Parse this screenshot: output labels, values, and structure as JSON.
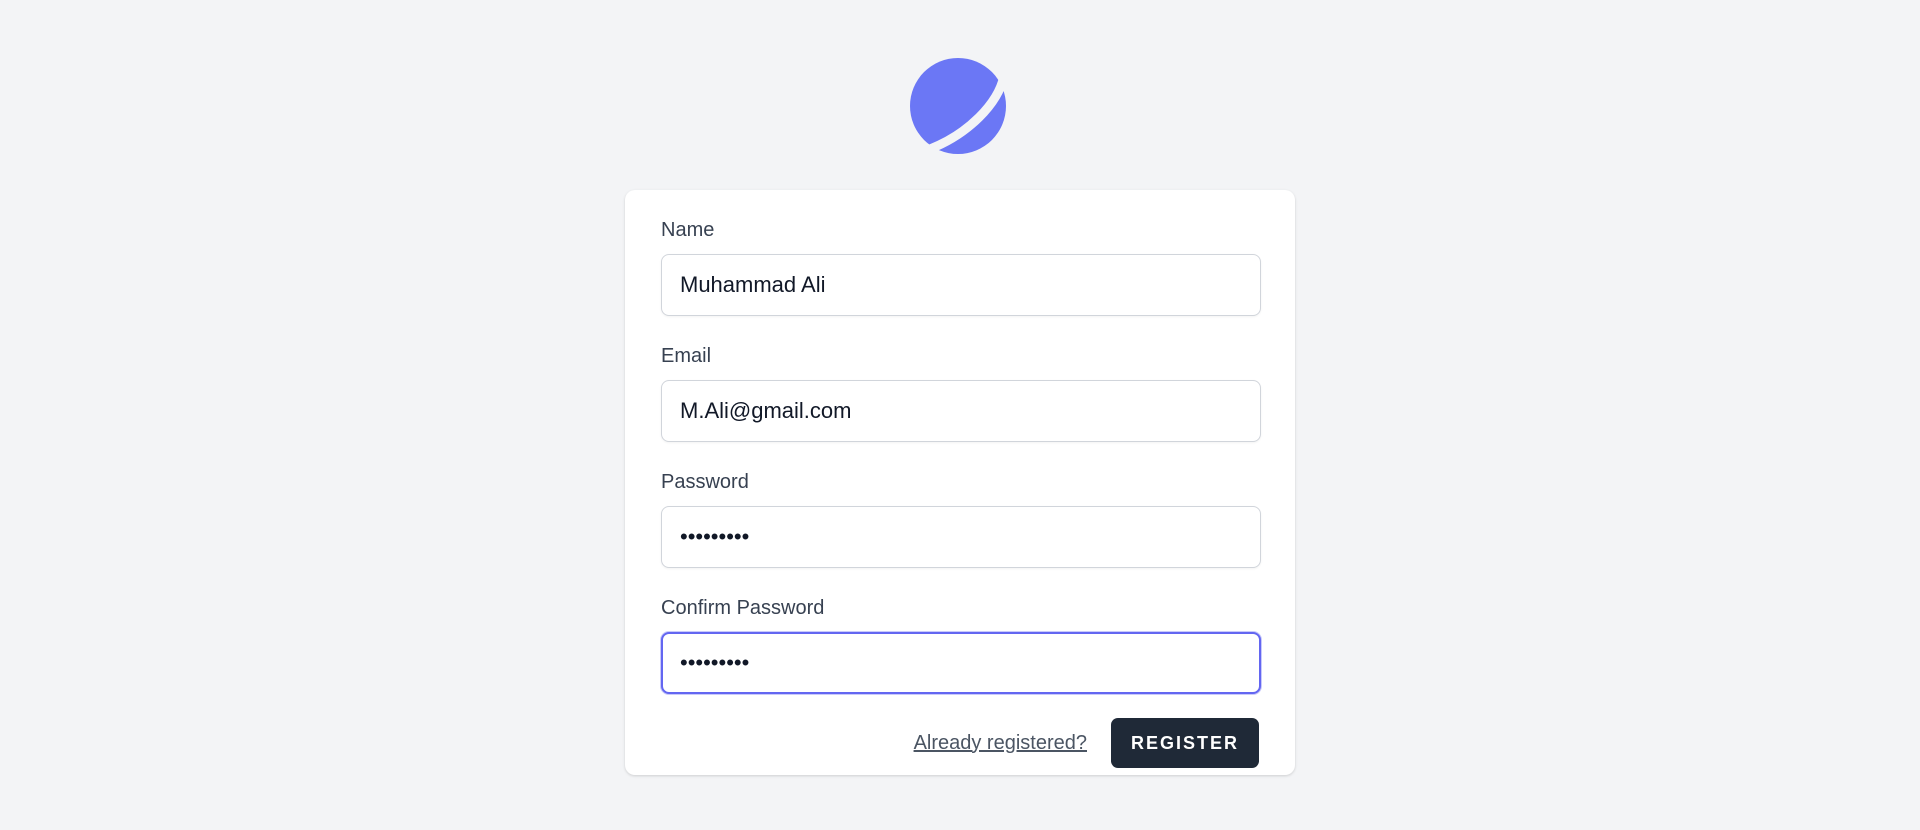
{
  "logo": {
    "icon": "planet-logo-icon",
    "color": "#6b77f5"
  },
  "form": {
    "name": {
      "label": "Name",
      "value": "Muhammad Ali"
    },
    "email": {
      "label": "Email",
      "value": "M.Ali@gmail.com"
    },
    "password": {
      "label": "Password",
      "value": "•••••••••"
    },
    "confirm_password": {
      "label": "Confirm Password",
      "value": "•••••••••"
    }
  },
  "actions": {
    "login_link_label": "Already registered?",
    "register_label": "REGISTER"
  },
  "colors": {
    "background": "#f3f4f6",
    "focus_ring": "#6366f1",
    "button": "#1f2937"
  }
}
